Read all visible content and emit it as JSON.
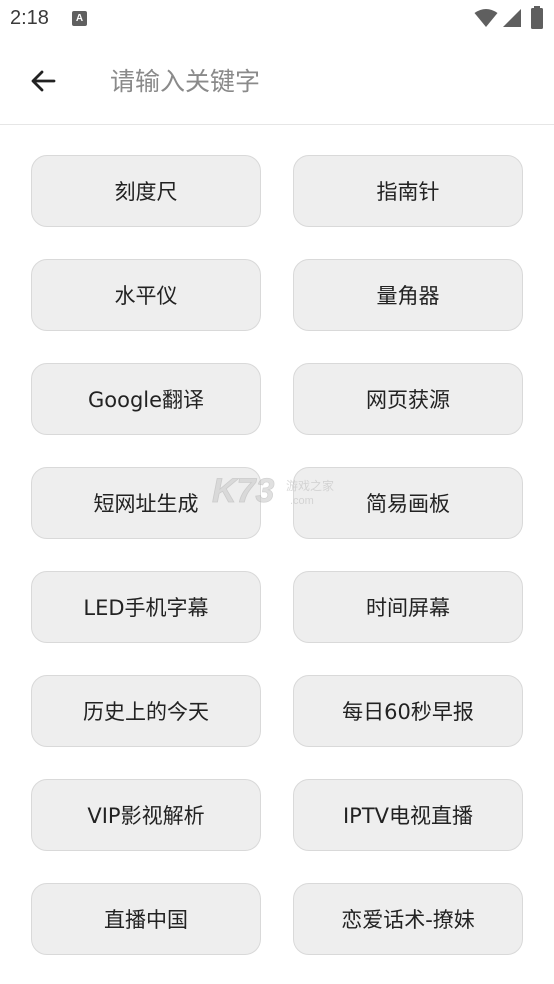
{
  "status_bar": {
    "time": "2:18",
    "notification_badge": "A"
  },
  "search": {
    "placeholder": "请输入关键字",
    "value": ""
  },
  "tools": [
    {
      "label": "刻度尺",
      "name": "tool-ruler"
    },
    {
      "label": "指南针",
      "name": "tool-compass"
    },
    {
      "label": "水平仪",
      "name": "tool-level"
    },
    {
      "label": "量角器",
      "name": "tool-protractor"
    },
    {
      "label": "Google翻译",
      "name": "tool-google-translate"
    },
    {
      "label": "网页获源",
      "name": "tool-webpage-source"
    },
    {
      "label": "短网址生成",
      "name": "tool-short-url"
    },
    {
      "label": "简易画板",
      "name": "tool-drawing-board"
    },
    {
      "label": "LED手机字幕",
      "name": "tool-led-subtitle"
    },
    {
      "label": "时间屏幕",
      "name": "tool-time-screen"
    },
    {
      "label": "历史上的今天",
      "name": "tool-today-in-history"
    },
    {
      "label": "每日60秒早报",
      "name": "tool-daily-news"
    },
    {
      "label": "VIP影视解析",
      "name": "tool-vip-video"
    },
    {
      "label": "IPTV电视直播",
      "name": "tool-iptv-live"
    },
    {
      "label": "直播中国",
      "name": "tool-live-china"
    },
    {
      "label": "恋爱话术-撩妹",
      "name": "tool-love-talk"
    }
  ],
  "watermark": {
    "logo_text": "K73",
    "site_text": "游戏之家",
    "domain_text": ".com"
  },
  "colors": {
    "button_bg": "#eeeeee",
    "button_border": "#d9d9d9",
    "text": "#222222",
    "placeholder": "#8a8a8a"
  }
}
